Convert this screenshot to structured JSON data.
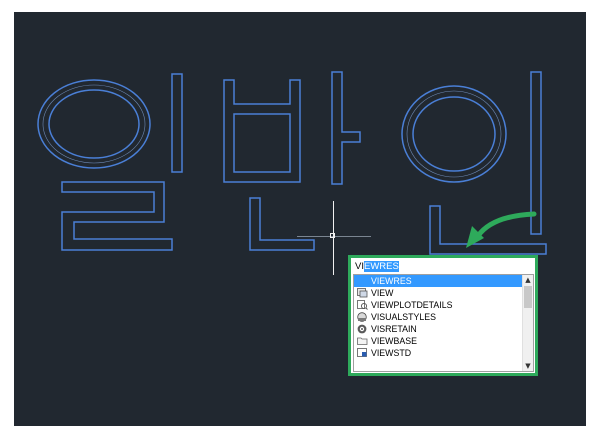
{
  "drawing": {
    "hangul_text": "일반인",
    "outline_color": "#4a7fd6",
    "background_color": "#212830"
  },
  "autocomplete": {
    "typed_text": "VI",
    "selected_completion": "EWRES",
    "border_color": "#2eaa5b",
    "items": [
      {
        "label": "VIEWRES",
        "icon": "blank",
        "selected": true
      },
      {
        "label": "VIEW",
        "icon": "view-manager-icon",
        "selected": false
      },
      {
        "label": "VIEWPLOTDETAILS",
        "icon": "plot-details-icon",
        "selected": false
      },
      {
        "label": "VISUALSTYLES",
        "icon": "visual-styles-icon",
        "selected": false
      },
      {
        "label": "VISRETAIN",
        "icon": "gear-icon",
        "selected": false
      },
      {
        "label": "VIEWBASE",
        "icon": "folder-icon",
        "selected": false
      },
      {
        "label": "VIEWSTD",
        "icon": "viewstd-icon",
        "selected": false
      }
    ],
    "scrollbar": {
      "up": "▲",
      "down": "▼",
      "position": 0
    }
  }
}
